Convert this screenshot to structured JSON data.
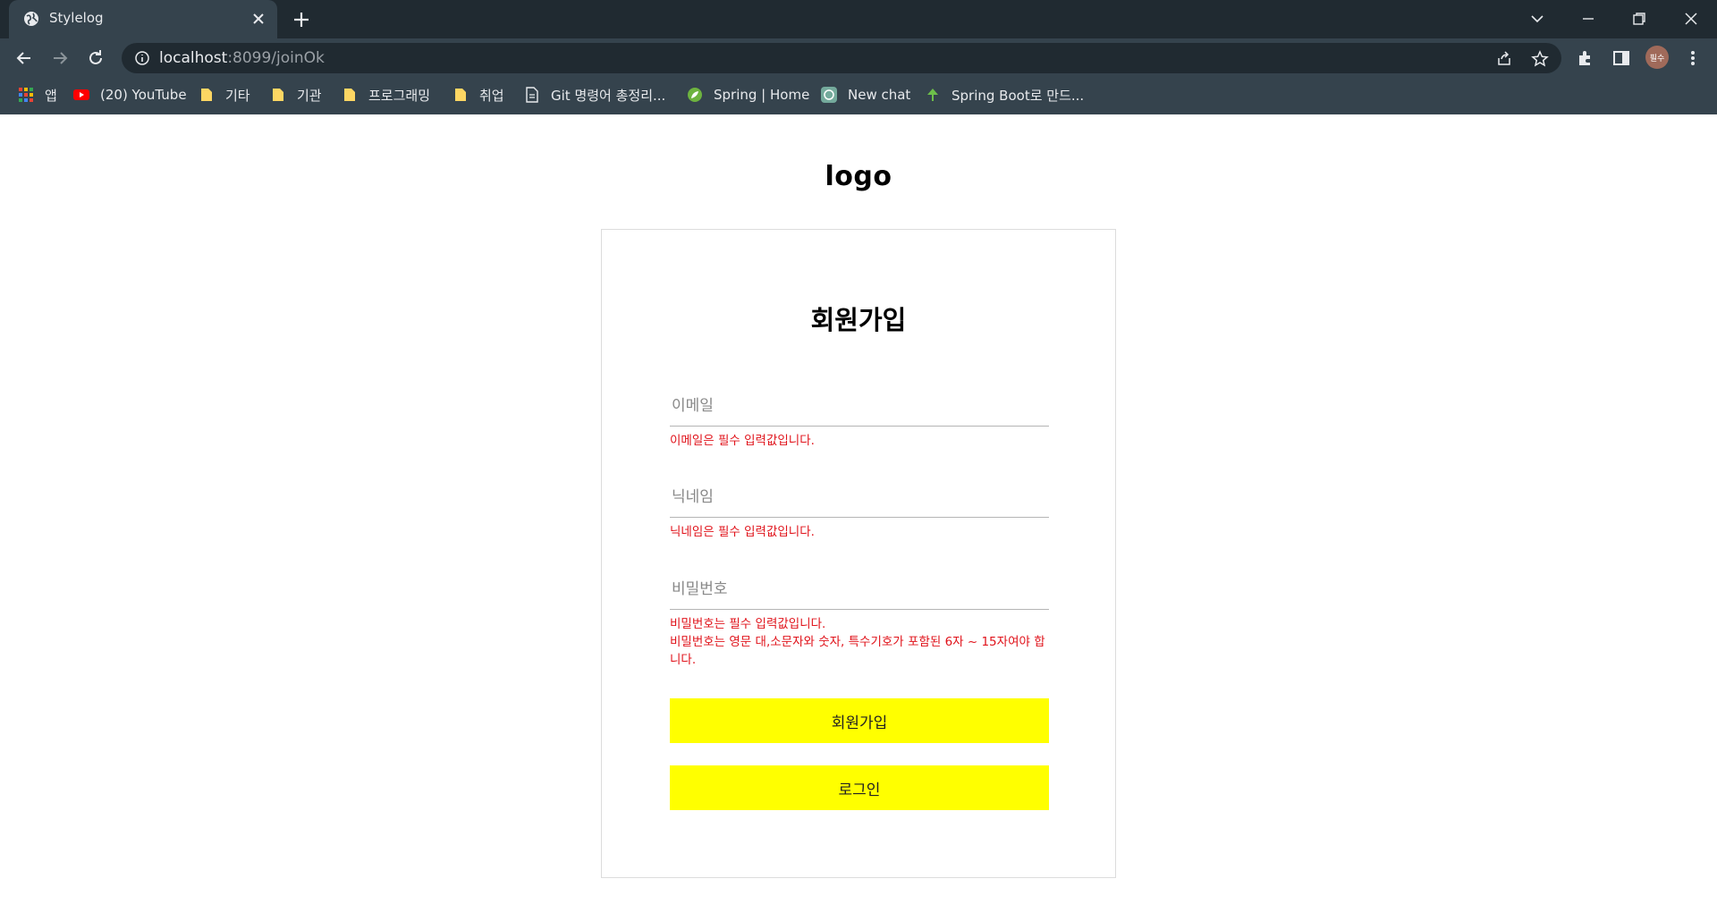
{
  "browser": {
    "tab_title": "Stylelog",
    "url_host": "localhost",
    "url_rest": ":8099/joinOk",
    "profile": "필수",
    "bookmarks": [
      {
        "label": "앱",
        "icon": "apps-grid-icon"
      },
      {
        "label": "(20) YouTube",
        "icon": "youtube-icon"
      },
      {
        "label": "기타",
        "icon": "folder-icon"
      },
      {
        "label": "기관",
        "icon": "folder-icon"
      },
      {
        "label": "프로그래밍",
        "icon": "folder-icon"
      },
      {
        "label": "취업",
        "icon": "folder-icon"
      },
      {
        "label": "Git 명령어 총정리...",
        "icon": "document-icon"
      },
      {
        "label": "Spring | Home",
        "icon": "spring-leaf-icon"
      },
      {
        "label": "New chat",
        "icon": "chatgpt-icon"
      },
      {
        "label": "Spring Boot로 만드...",
        "icon": "tree-icon"
      }
    ]
  },
  "page": {
    "logo": "logo",
    "title": "회원가입",
    "email": {
      "placeholder": "이메일",
      "value": "",
      "errors": [
        "이메일은 필수 입력값입니다."
      ]
    },
    "nickname": {
      "placeholder": "닉네임",
      "value": "",
      "errors": [
        "닉네임은 필수 입력값입니다."
      ]
    },
    "password": {
      "placeholder": "비밀번호",
      "value": "",
      "errors": [
        "비밀번호는 필수 입력값입니다.",
        "비밀번호는 영문 대,소문자와 숫자, 특수기호가 포함된 6자 ~ 15자여야 합니다."
      ]
    },
    "join_button": "회원가입",
    "login_button": "로그인",
    "button_color": "#ffff00",
    "error_color": "#e0121a"
  }
}
